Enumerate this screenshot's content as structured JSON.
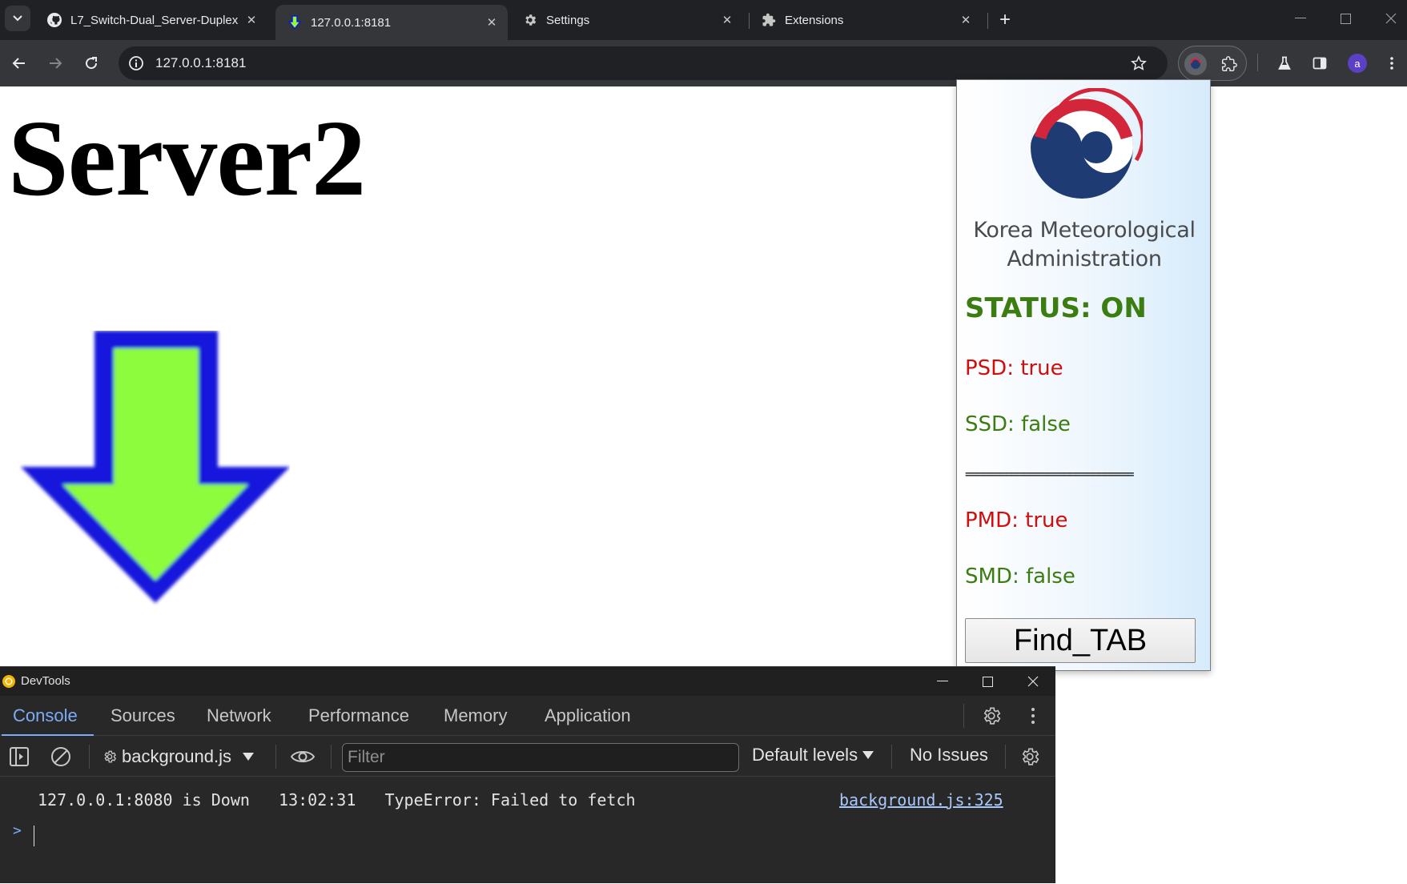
{
  "browser": {
    "tabs": [
      {
        "title": "L7_Switch-Dual_Server-Duplex",
        "favicon": "github-icon",
        "active": false
      },
      {
        "title": "127.0.0.1:8181",
        "favicon": "green-down-arrow-icon",
        "active": true
      },
      {
        "title": "Settings",
        "favicon": "gear-icon",
        "active": false
      },
      {
        "title": "Extensions",
        "favicon": "puzzle-icon",
        "active": false
      }
    ],
    "address": "127.0.0.1:8181",
    "profile_initial": "a"
  },
  "page": {
    "heading": "Server2",
    "arrow_colors": {
      "fill": "#8cfc3c",
      "outline": "#1414dc"
    }
  },
  "popup": {
    "org_line1": "Korea Meteorological",
    "org_line2": "Administration",
    "status": "STATUS: ON",
    "psd": "PSD: true",
    "ssd": "SSD: false",
    "divider": "=============================",
    "pmd": "PMD: true",
    "smd": "SMD: false",
    "button": "Find_TAB",
    "colors": {
      "on": "#3b7d11",
      "true_value": "#d10e0e",
      "false_value": "#3b7d11"
    }
  },
  "devtools": {
    "title": "DevTools",
    "tabs": [
      "Console",
      "Sources",
      "Network",
      "Performance",
      "Memory",
      "Application"
    ],
    "active_tab": "Console",
    "context": "background.js",
    "filter_placeholder": "Filter",
    "levels": "Default levels",
    "issues": "No Issues",
    "log": {
      "message": "127.0.0.1:8080 is Down   13:02:31   TypeError: Failed to fetch",
      "source": "background.js:325"
    },
    "prompt": ">"
  }
}
